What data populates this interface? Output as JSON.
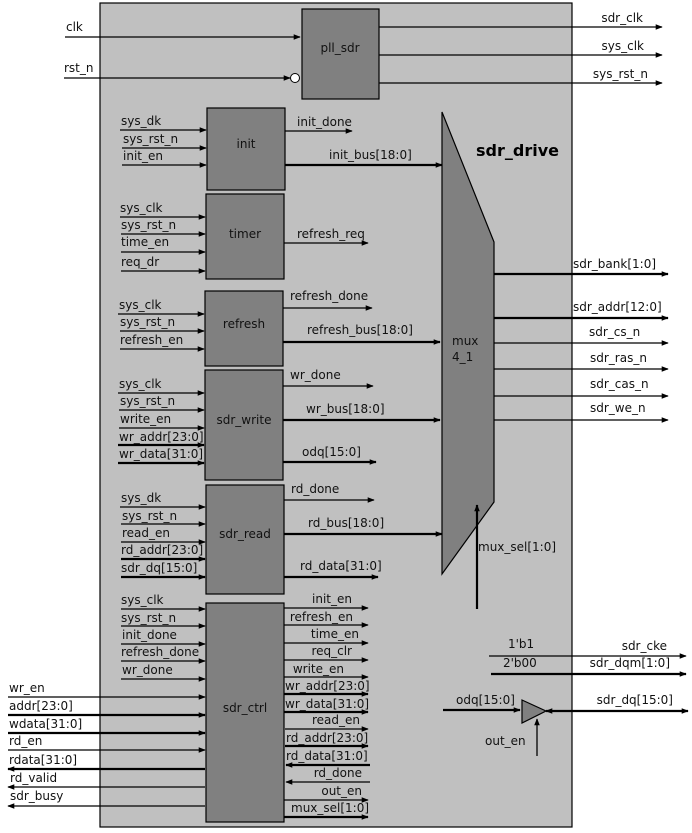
{
  "diagram": {
    "title": "sdr_drive",
    "colors": {
      "outer_fill": "#c0c0c0",
      "block_fill": "#808080",
      "line": "#000000",
      "background": "#ffffff"
    },
    "top_inputs": [
      "clk",
      "rst_n"
    ],
    "pll": {
      "name": "pll_sdr",
      "outputs": [
        "sdr_clk",
        "sys_clk",
        "sys_rst_n"
      ]
    },
    "blocks": [
      {
        "name": "init",
        "inputs": [
          "sys_dk",
          "sys_rst_n",
          "init_en"
        ],
        "outputs": [
          "init_done",
          "init_bus[18:0]"
        ]
      },
      {
        "name": "timer",
        "inputs": [
          "sys_clk",
          "sys_rst_n",
          "time_en",
          "req_dr"
        ],
        "outputs": [
          "refresh_req"
        ]
      },
      {
        "name": "refresh",
        "inputs": [
          "sys_clk",
          "sys_rst_n",
          "refresh_en"
        ],
        "outputs": [
          "refresh_done",
          "refresh_bus[18:0]"
        ]
      },
      {
        "name": "sdr_write",
        "inputs": [
          "sys_clk",
          "sys_rst_n",
          "write_en",
          "wr_addr[23:0]",
          "wr_data[31:0]"
        ],
        "outputs": [
          "wr_done",
          "wr_bus[18:0]",
          "odq[15:0]"
        ]
      },
      {
        "name": "sdr_read",
        "inputs": [
          "sys_dk",
          "sys_rst_n",
          "read_en",
          "rd_addr[23:0]",
          "sdr_dq[15:0]"
        ],
        "outputs": [
          "rd_done",
          "rd_bus[18:0]",
          "rd_data[31:0]"
        ]
      }
    ],
    "ctrl": {
      "name": "sdr_ctrl",
      "inputs": [
        "sys_clk",
        "sys_rst_n",
        "init_done",
        "refresh_done",
        "wr_done"
      ],
      "ext_ports": [
        "wr_en",
        "addr[23:0]",
        "wdata[31:0]",
        "rd_en",
        "rdata[31:0]",
        "rd_valid",
        "sdr_busy"
      ],
      "outputs": [
        "init_en",
        "refresh_en",
        "time_en",
        "req_clr",
        "write_en",
        "wr_addr[23:0]",
        "wr_data[31:0]",
        "read_en",
        "rd_addr[23:0]",
        "rd_data[31:0]",
        "rd_done",
        "out_en",
        "mux_sel[1:0]"
      ]
    },
    "mux": {
      "name_line1": "mux",
      "name_line2": "4_1",
      "select": "mux_sel[1:0]",
      "outputs": [
        "sdr_bank[1:0]",
        "sdr_addr[12:0]",
        "sdr_cs_n",
        "sdr_ras_n",
        "sdr_cas_n",
        "sdr_we_n"
      ]
    },
    "constants": [
      {
        "value": "1'b1",
        "port": "sdr_cke"
      },
      {
        "value": "2'b00",
        "port": "sdr_dqm[1:0]"
      }
    ],
    "tristate": {
      "input": "odq[15:0]",
      "enable": "out_en",
      "port": "sdr_dq[15:0]"
    }
  }
}
